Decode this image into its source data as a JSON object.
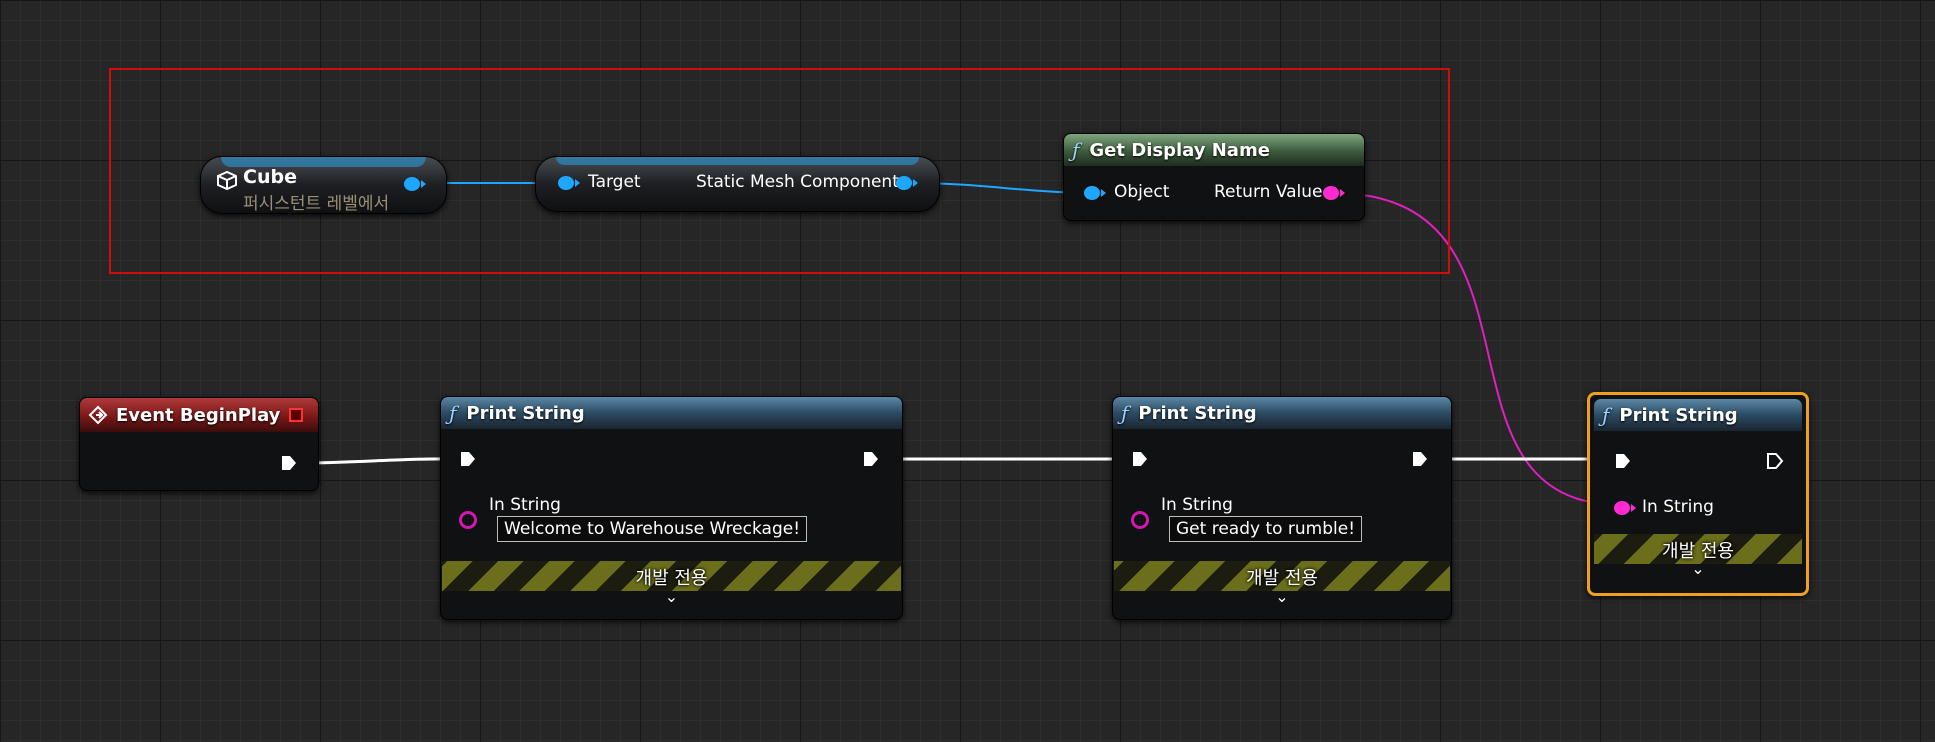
{
  "nodes": {
    "cube": {
      "title": "Cube",
      "subtitle": "퍼시스턴트 레벨에서"
    },
    "static_mesh": {
      "target_label": "Target",
      "output_label": "Static Mesh Component"
    },
    "get_display_name": {
      "title": "Get Display Name",
      "input_label": "Object",
      "output_label": "Return Value"
    },
    "event_beginplay": {
      "title": "Event BeginPlay"
    },
    "print1": {
      "title": "Print String",
      "in_string_label": "In String",
      "value": "Welcome to Warehouse Wreckage!",
      "dev_only": "개발 전용"
    },
    "print2": {
      "title": "Print String",
      "in_string_label": "In String",
      "value": "Get ready to rumble!",
      "dev_only": "개발 전용"
    },
    "print3": {
      "title": "Print String",
      "in_string_label": "In String",
      "dev_only": "개발 전용"
    }
  },
  "icons": {
    "function": "ƒ",
    "chevron": "⌄"
  },
  "colors": {
    "object_pin": "#1ea7ff",
    "string_pin": "#ff2bd0",
    "exec_wire": "#ffffff",
    "selection": "#f0a020",
    "comment_box": "#d10c0c"
  }
}
